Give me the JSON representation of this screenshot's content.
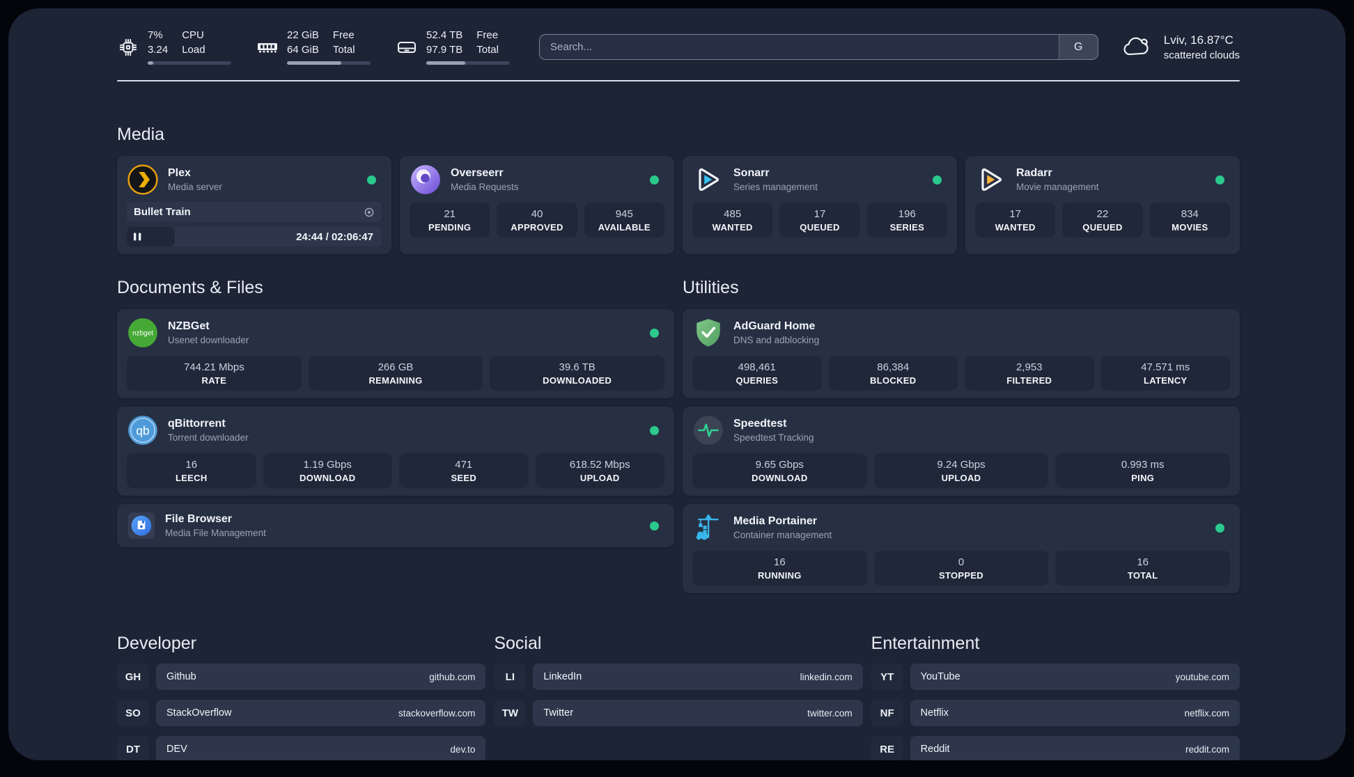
{
  "header": {
    "system": [
      {
        "icon": "cpu-icon",
        "value_top": "7%",
        "value_bottom": "3.24",
        "label_top": "CPU",
        "label_bottom": "Load",
        "progress_pct": 7
      },
      {
        "icon": "memory-icon",
        "value_top": "22 GiB",
        "value_bottom": "64 GiB",
        "label_top": "Free",
        "label_bottom": "Total",
        "progress_pct": 65
      },
      {
        "icon": "disk-icon",
        "value_top": "52.4 TB",
        "value_bottom": "97.9 TB",
        "label_top": "Free",
        "label_bottom": "Total",
        "progress_pct": 47
      }
    ],
    "search": {
      "placeholder": "Search...",
      "engine_button": "G"
    },
    "weather": {
      "icon": "cloud-icon",
      "location_temperature": "Lviv, 16.87°C",
      "condition": "scattered clouds"
    }
  },
  "sections": {
    "media": "Media",
    "documents": "Documents & Files",
    "utilities": "Utilities",
    "developer": "Developer",
    "social": "Social",
    "entertainment": "Entertainment"
  },
  "apps": {
    "plex": {
      "name": "Plex",
      "subtitle": "Media server",
      "online": true,
      "now_playing": {
        "title": "Bullet Train",
        "time": "24:44 / 02:06:47",
        "progress_pct": 19.5
      }
    },
    "overseerr": {
      "name": "Overseerr",
      "subtitle": "Media Requests",
      "online": true,
      "stats": [
        {
          "value": "21",
          "label": "PENDING"
        },
        {
          "value": "40",
          "label": "APPROVED"
        },
        {
          "value": "945",
          "label": "AVAILABLE"
        }
      ]
    },
    "sonarr": {
      "name": "Sonarr",
      "subtitle": "Series management",
      "online": true,
      "stats": [
        {
          "value": "485",
          "label": "WANTED"
        },
        {
          "value": "17",
          "label": "QUEUED"
        },
        {
          "value": "196",
          "label": "SERIES"
        }
      ]
    },
    "radarr": {
      "name": "Radarr",
      "subtitle": "Movie management",
      "online": true,
      "stats": [
        {
          "value": "17",
          "label": "WANTED"
        },
        {
          "value": "22",
          "label": "QUEUED"
        },
        {
          "value": "834",
          "label": "MOVIES"
        }
      ]
    },
    "nzbget": {
      "name": "NZBGet",
      "subtitle": "Usenet downloader",
      "online": true,
      "stats": [
        {
          "value": "744.21 Mbps",
          "label": "RATE"
        },
        {
          "value": "266 GB",
          "label": "REMAINING"
        },
        {
          "value": "39.6 TB",
          "label": "DOWNLOADED"
        }
      ]
    },
    "qbittorrent": {
      "name": "qBittorrent",
      "subtitle": "Torrent downloader",
      "online": true,
      "stats": [
        {
          "value": "16",
          "label": "LEECH"
        },
        {
          "value": "1.19 Gbps",
          "label": "DOWNLOAD"
        },
        {
          "value": "471",
          "label": "SEED"
        },
        {
          "value": "618.52 Mbps",
          "label": "UPLOAD"
        }
      ]
    },
    "filebrowser": {
      "name": "File Browser",
      "subtitle": "Media File Management",
      "online": true
    },
    "adguard": {
      "name": "AdGuard Home",
      "subtitle": "DNS and adblocking",
      "online": false,
      "stats": [
        {
          "value": "498,461",
          "label": "QUERIES"
        },
        {
          "value": "86,384",
          "label": "BLOCKED"
        },
        {
          "value": "2,953",
          "label": "FILTERED"
        },
        {
          "value": "47.571 ms",
          "label": "LATENCY"
        }
      ]
    },
    "speedtest": {
      "name": "Speedtest",
      "subtitle": "Speedtest Tracking",
      "online": false,
      "stats": [
        {
          "value": "9.65 Gbps",
          "label": "DOWNLOAD"
        },
        {
          "value": "9.24 Gbps",
          "label": "UPLOAD"
        },
        {
          "value": "0.993 ms",
          "label": "PING"
        }
      ]
    },
    "portainer": {
      "name": "Media Portainer",
      "subtitle": "Container management",
      "online": true,
      "stats": [
        {
          "value": "16",
          "label": "RUNNING"
        },
        {
          "value": "0",
          "label": "STOPPED"
        },
        {
          "value": "16",
          "label": "TOTAL"
        }
      ]
    }
  },
  "links": {
    "developer": [
      {
        "tag": "GH",
        "name": "Github",
        "url": "github.com"
      },
      {
        "tag": "SO",
        "name": "StackOverflow",
        "url": "stackoverflow.com"
      },
      {
        "tag": "DT",
        "name": "DEV",
        "url": "dev.to"
      }
    ],
    "social": [
      {
        "tag": "LI",
        "name": "LinkedIn",
        "url": "linkedin.com"
      },
      {
        "tag": "TW",
        "name": "Twitter",
        "url": "twitter.com"
      }
    ],
    "entertainment": [
      {
        "tag": "YT",
        "name": "YouTube",
        "url": "youtube.com"
      },
      {
        "tag": "NF",
        "name": "Netflix",
        "url": "netflix.com"
      },
      {
        "tag": "RE",
        "name": "Reddit",
        "url": "reddit.com"
      }
    ]
  },
  "icons": {
    "nzbget_label": "nzbget",
    "qbittorrent_label": "qb"
  },
  "colors": {
    "status_online": "#2bc98c",
    "panel_bg": "#1d2436",
    "card_bg": "#272f43",
    "plex_accent": "#e5a00d",
    "sonarr_accent": "#37c3f2",
    "radarr_accent": "#ffb53c",
    "adguard_accent": "#67b279",
    "portainer_accent": "#38b6ea"
  }
}
